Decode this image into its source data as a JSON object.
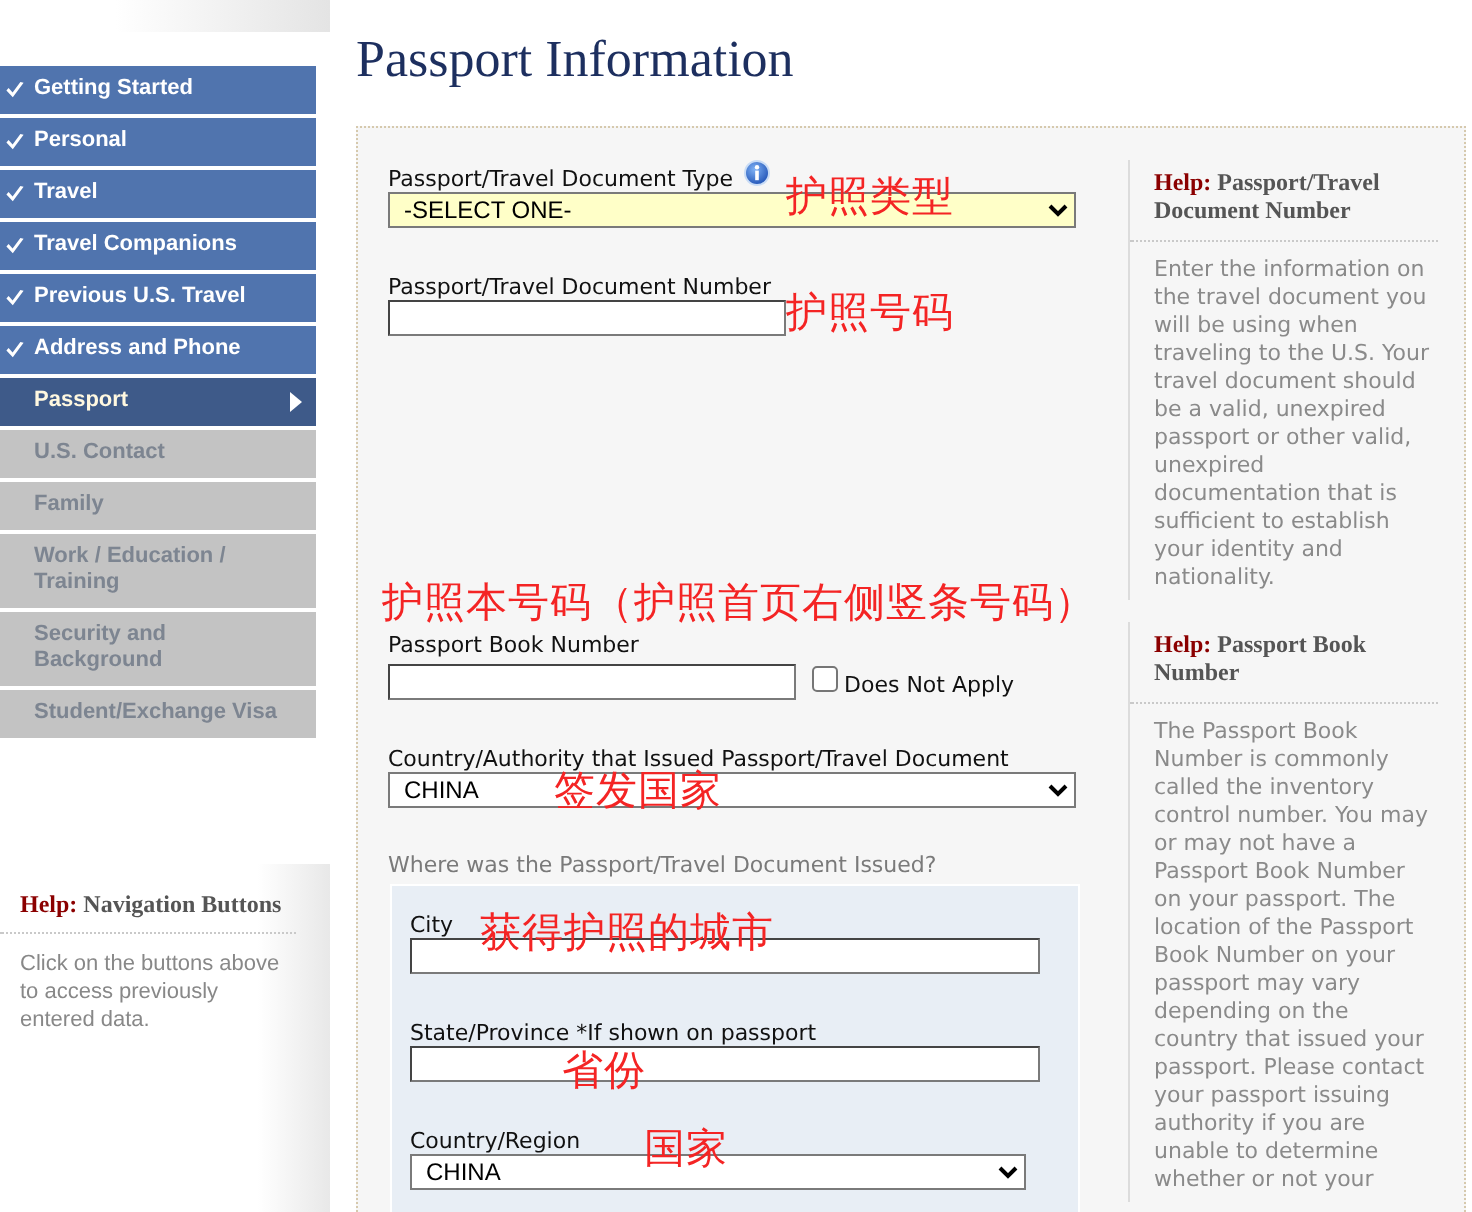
{
  "sidebar": {
    "items": [
      {
        "label": "Getting Started",
        "completed": true,
        "selected": false
      },
      {
        "label": "Personal",
        "completed": true,
        "selected": false
      },
      {
        "label": "Travel",
        "completed": true,
        "selected": false
      },
      {
        "label": "Travel Companions",
        "completed": true,
        "selected": false
      },
      {
        "label": "Previous U.S. Travel",
        "completed": true,
        "selected": false
      },
      {
        "label": "Address and Phone",
        "completed": true,
        "selected": false
      },
      {
        "label": "Passport",
        "completed": false,
        "selected": true
      },
      {
        "label": "U.S. Contact",
        "completed": false,
        "selected": false
      },
      {
        "label": "Family",
        "completed": false,
        "selected": false
      },
      {
        "label": "Work / Education / Training",
        "completed": false,
        "selected": false
      },
      {
        "label": "Security and Background",
        "completed": false,
        "selected": false
      },
      {
        "label": "Student/Exchange Visa",
        "completed": false,
        "selected": false
      }
    ]
  },
  "nav_help": {
    "label": "Help:",
    "title": "Navigation Buttons",
    "text": "Click on the buttons above to access previously entered data."
  },
  "page_title": "Passport Information",
  "form": {
    "fields": [
      {
        "kind": "select",
        "label": "Passport/Travel Document Type",
        "value": "-SELECT ONE-",
        "info_icon": true,
        "highlighted": true,
        "annotation": "护照类型"
      },
      {
        "kind": "text",
        "label": "Passport/Travel Document Number",
        "info_icon": false,
        "highlighted": false,
        "annotation": "护照号码"
      },
      {
        "kind": "text",
        "label": "Passport Book Number",
        "info_icon": false,
        "highlighted": false,
        "annotation": "护照本号码（护照首页右侧竖条号码）",
        "does_not_apply": {
          "label": "Does Not Apply",
          "checked": false
        }
      },
      {
        "kind": "select",
        "label": "Country/Authority that Issued Passport/Travel Document",
        "value": "CHINA",
        "info_icon": false,
        "highlighted": false,
        "annotation": "签发国家"
      }
    ],
    "issued": {
      "question": "Where was the Passport/Travel Document Issued?",
      "fields": [
        {
          "kind": "text",
          "label": "City",
          "annotation": "获得护照的城市"
        },
        {
          "kind": "text",
          "label": "State/Province *If shown on passport",
          "annotation": "省份"
        },
        {
          "kind": "select",
          "label": "Country/Region",
          "value": "CHINA",
          "annotation": "国家"
        }
      ]
    }
  },
  "help": [
    {
      "label": "Help:",
      "title": "Passport/Travel Document Number",
      "text": "Enter the information on the travel document you will be using when traveling to the U.S. Your travel document should be a valid, unexpired passport or other valid, unexpired documentation that is sufficient to establish your identity and nationality."
    },
    {
      "label": "Help:",
      "title": "Passport Book Number",
      "text": "The Passport Book Number is commonly called the inventory control number. You may or may not have a Passport Book Number on your passport. The location of the Passport Book Number on your passport may vary depending on the country that issued your passport. Please contact your passport issuing authority if you are unable to determine whether or not your"
    }
  ]
}
